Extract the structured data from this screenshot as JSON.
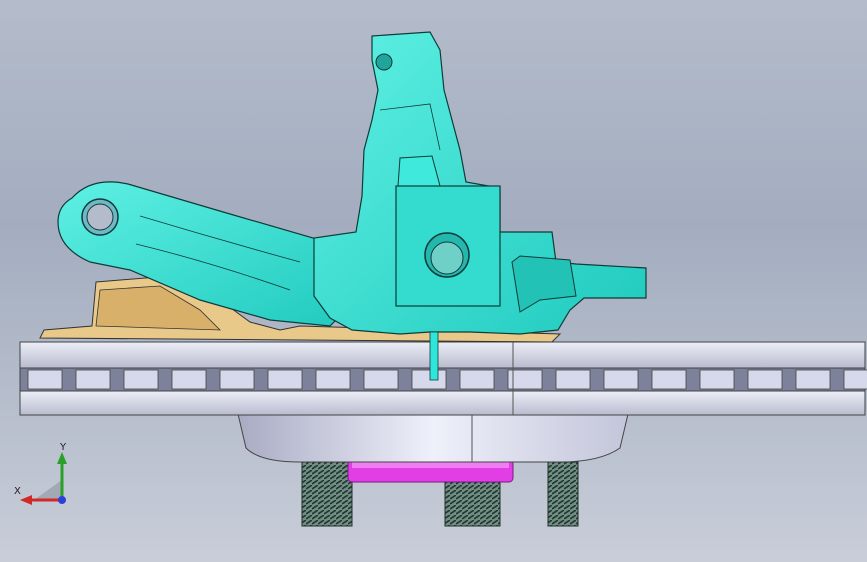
{
  "viewport": {
    "colors": {
      "background_top": "#b4bccb",
      "knuckle": "#2ee6d9",
      "knuckle_shadow": "#1fbfb4",
      "caliper_bracket": "#e9c98a",
      "rotor": "#d9dbe8",
      "rotor_dark": "#8d90a6",
      "hub": "#cfd1e6",
      "bearing": "#e23ee6",
      "stud": "#4b7a6b"
    },
    "parts": [
      "steering-knuckle",
      "steering-arm",
      "brake-caliper-bracket",
      "brake-rotor",
      "wheel-hub",
      "hub-bearing",
      "wheel-studs"
    ]
  },
  "triad": {
    "x_label": "X",
    "y_label": "Y"
  }
}
